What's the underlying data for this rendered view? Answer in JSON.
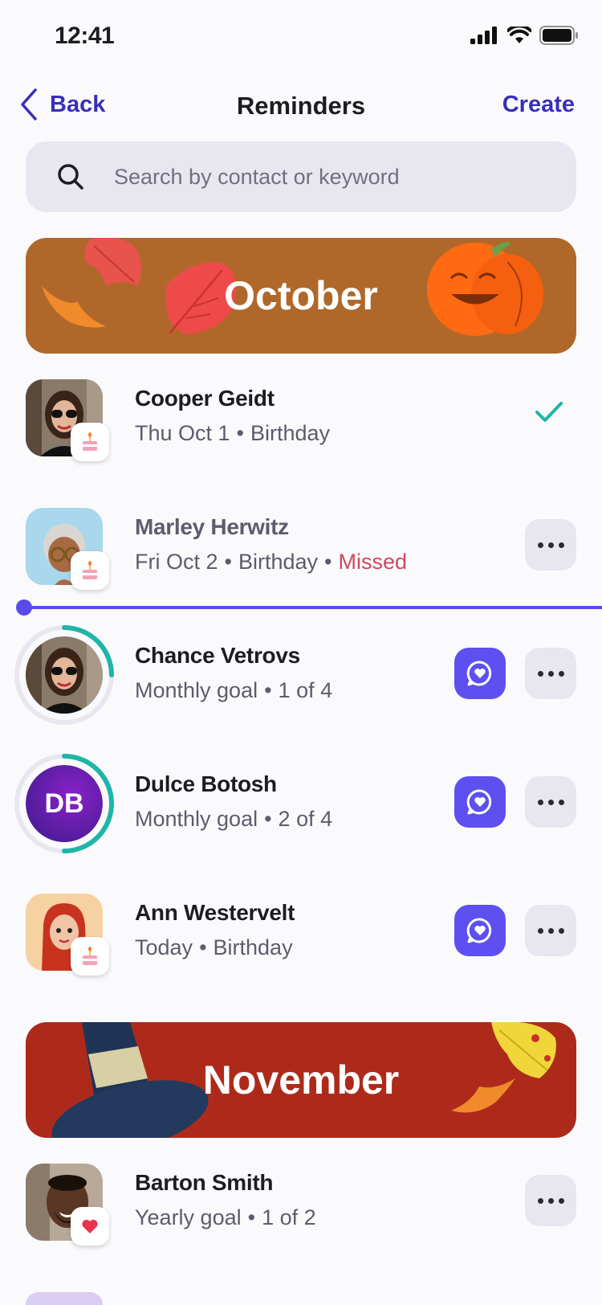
{
  "status_bar": {
    "time": "12:41"
  },
  "nav": {
    "back_label": "Back",
    "title": "Reminders",
    "create_label": "Create"
  },
  "search": {
    "placeholder": "Search by contact or keyword"
  },
  "sections": [
    {
      "month": "October"
    },
    {
      "month": "November"
    }
  ],
  "reminders": [
    {
      "name": "Cooper Geidt",
      "date": "Thu Oct 1",
      "type": "Birthday",
      "state": "done",
      "badge": "cake-icon"
    },
    {
      "name": "Marley Herwitz",
      "date": "Fri Oct 2",
      "type": "Birthday",
      "status": "Missed",
      "badge": "cake-icon"
    },
    {
      "name": "Chance Vetrovs",
      "date": "Monthly goal",
      "type": "1 of 4",
      "progress": 0.25
    },
    {
      "name": "Dulce Botosh",
      "initials": "DB",
      "date": "Monthly goal",
      "type": "2 of 4",
      "progress": 0.5
    },
    {
      "name": "Ann Westervelt",
      "date": "Today",
      "type": "Birthday",
      "badge": "cake-icon"
    },
    {
      "name": "Barton Smith",
      "date": "Yearly goal",
      "type": "1 of 2",
      "badge": "heart-icon"
    }
  ],
  "colors": {
    "accent": "#5e4ff0",
    "link": "#3a2fb8",
    "missed": "#d0475e",
    "check": "#1fb5a8",
    "october_banner": "#b0682a",
    "november_banner": "#ad2a1a"
  }
}
